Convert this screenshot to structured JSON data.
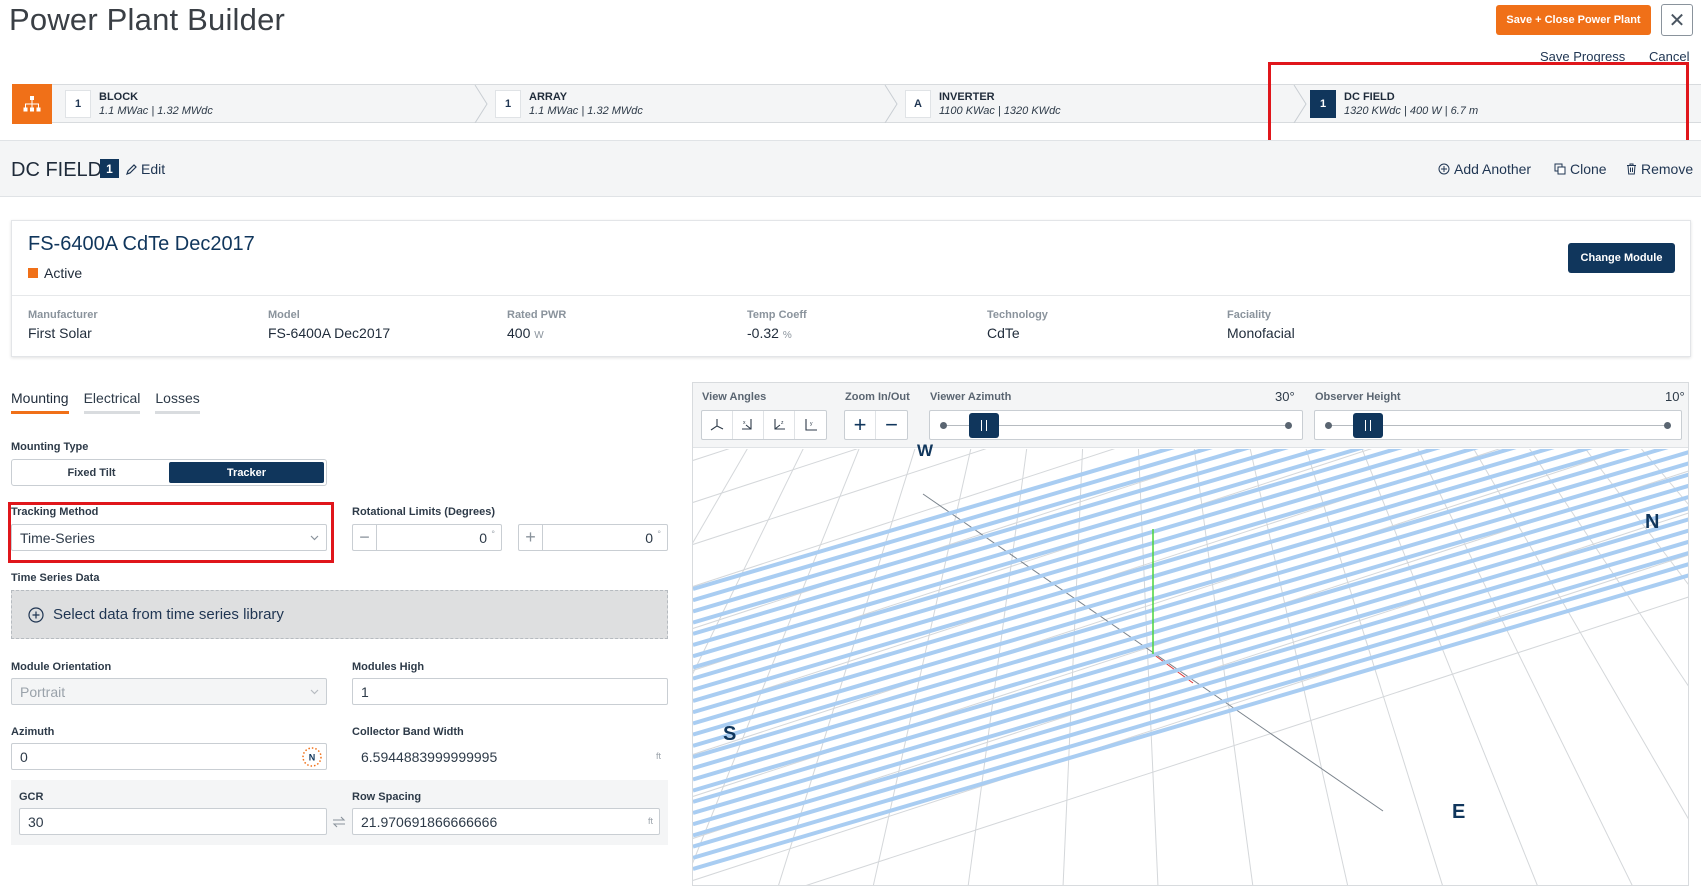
{
  "header": {
    "title": "Power Plant Builder",
    "save_close_label": "Save + Close Power Plant",
    "close_symbol": "✕",
    "save_progress_label": "Save Progress",
    "cancel_label": "Cancel"
  },
  "breadcrumbs": {
    "home_icon": "hierarchy-icon",
    "items": [
      {
        "badge": "1",
        "title": "BLOCK",
        "subtitle": "1.1 MWac | 1.32 MWdc"
      },
      {
        "badge": "1",
        "title": "ARRAY",
        "subtitle": "1.1 MWac | 1.32 MWdc"
      },
      {
        "badge": "A",
        "title": "INVERTER",
        "subtitle": "1100 KWac | 1320 KWdc"
      },
      {
        "badge": "1",
        "title": "DC FIELD",
        "subtitle": "1320 KWdc | 400 W | 6.7 m"
      }
    ]
  },
  "subheader": {
    "title": "DC FIELD",
    "badge": "1",
    "edit_label": "Edit",
    "add_another_label": "Add Another",
    "clone_label": "Clone",
    "remove_label": "Remove"
  },
  "module": {
    "name": "FS-6400A CdTe Dec2017",
    "status": "Active",
    "change_module_label": "Change Module",
    "fields": [
      {
        "label": "Manufacturer",
        "value": "First Solar",
        "unit": ""
      },
      {
        "label": "Model",
        "value": "FS-6400A Dec2017",
        "unit": ""
      },
      {
        "label": "Rated PWR",
        "value": "400",
        "unit": "W"
      },
      {
        "label": "Temp Coeff",
        "value": "-0.32",
        "unit": "%"
      },
      {
        "label": "Technology",
        "value": "CdTe",
        "unit": ""
      },
      {
        "label": "Faciality",
        "value": "Monofacial",
        "unit": ""
      }
    ]
  },
  "tabs": [
    "Mounting",
    "Electrical",
    "Losses"
  ],
  "form": {
    "mounting_type_label": "Mounting Type",
    "mounting_options": [
      "Fixed Tilt",
      "Tracker"
    ],
    "tracking_method_label": "Tracking Method",
    "tracking_method_value": "Time-Series",
    "rotational_limits_label": "Rotational Limits (Degrees)",
    "rot_min_value": "0",
    "rot_max_value": "0",
    "degree_symbol": "°",
    "time_series_label": "Time Series Data",
    "time_series_button": "Select data from time series library",
    "module_orientation_label": "Module Orientation",
    "module_orientation_value": "Portrait",
    "modules_high_label": "Modules High",
    "modules_high_value": "1",
    "azimuth_label": "Azimuth",
    "azimuth_value": "0",
    "azimuth_compass_letter": "N",
    "collector_band_label": "Collector Band Width",
    "collector_band_value": "6.5944883999999995",
    "collector_band_unit": "ft",
    "gcr_label": "GCR",
    "gcr_value": "30",
    "row_spacing_label": "Row Spacing",
    "row_spacing_value": "21.970691866666666",
    "row_spacing_unit": "ft"
  },
  "viewer": {
    "view_angles_label": "View Angles",
    "zoom_label": "Zoom In/Out",
    "zoom_in": "+",
    "zoom_out": "−",
    "viewer_azimuth_label": "Viewer Azimuth",
    "viewer_azimuth_value": "30°",
    "viewer_azimuth_fraction": 0.09,
    "observer_height_label": "Observer Height",
    "observer_height_value": "10°",
    "observer_height_fraction": 0.09,
    "compass": {
      "w": "W",
      "n": "N",
      "s": "S",
      "e": "E"
    },
    "row_color": "#a9cdf2",
    "accent": "#f07018",
    "navy": "#10365c"
  }
}
